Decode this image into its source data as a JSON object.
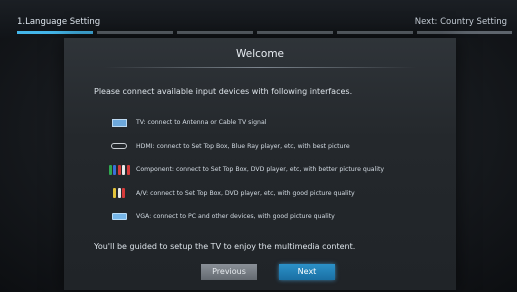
{
  "header": {
    "current_step": "1.Language Setting",
    "next_step": "Next: Country Setting"
  },
  "panel": {
    "title": "Welcome",
    "intro": "Please connect available input devices with following interfaces.",
    "items": [
      {
        "icon": "tv-icon",
        "text": "TV: connect to Antenna or Cable TV signal"
      },
      {
        "icon": "hdmi-icon",
        "text": "HDMI: connect to Set Top Box, Blue Ray player, etc, with best picture"
      },
      {
        "icon": "component-icon",
        "text": "Component: connect to Set Top Box, DVD player, etc, with better picture quality"
      },
      {
        "icon": "av-icon",
        "text": "A/V: connect to Set Top Box, DVD player, etc, with good picture quality"
      },
      {
        "icon": "vga-icon",
        "text": "VGA: connect to PC and other devices, with good picture quality"
      }
    ],
    "guide": "You'll be guided to setup the TV to enjoy the multimedia content."
  },
  "buttons": {
    "previous": "Previous",
    "next": "Next"
  },
  "colors": {
    "accent": "#44b6ea",
    "next_button": "#1f7fb6",
    "previous_button": "#757b82"
  }
}
